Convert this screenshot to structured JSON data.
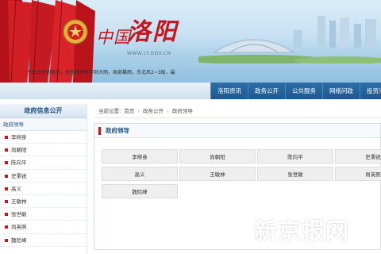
{
  "banner": {
    "logo_china": "中国",
    "logo_city": "洛阳",
    "site_url": "WWW.LY.GOV.CN",
    "ticker": "今天白天到夜里，全区阴天有中到大雨，局部暴雨，东北风2~3级，最"
  },
  "nav": {
    "items": [
      "洛阳资讯",
      "政务公开",
      "公共服务",
      "网络问政",
      "投资洛"
    ]
  },
  "sidebar": {
    "title": "政府信息公开",
    "section": "政府领导",
    "items": [
      "李柳身",
      "尚朝阳",
      "陈向平",
      "史秉锐",
      "高义",
      "王敏林",
      "张世敏",
      "尚英照",
      "魏险峰"
    ]
  },
  "breadcrumb": {
    "prefix": "当前位置:",
    "items": [
      "首页",
      "政务公开",
      "政府领导"
    ],
    "separator": "›"
  },
  "panel": {
    "title": "政府领导",
    "leaders": [
      "李柳身",
      "尚朝阳",
      "陈向平",
      "史秉锐",
      "高义",
      "王敏林",
      "张世敏",
      "尚英照",
      "魏险峰"
    ]
  },
  "watermark": "新京报网",
  "colors": {
    "brand_red": "#c4161c",
    "nav_blue": "#1d5890",
    "heading_blue": "#1d4f82"
  }
}
